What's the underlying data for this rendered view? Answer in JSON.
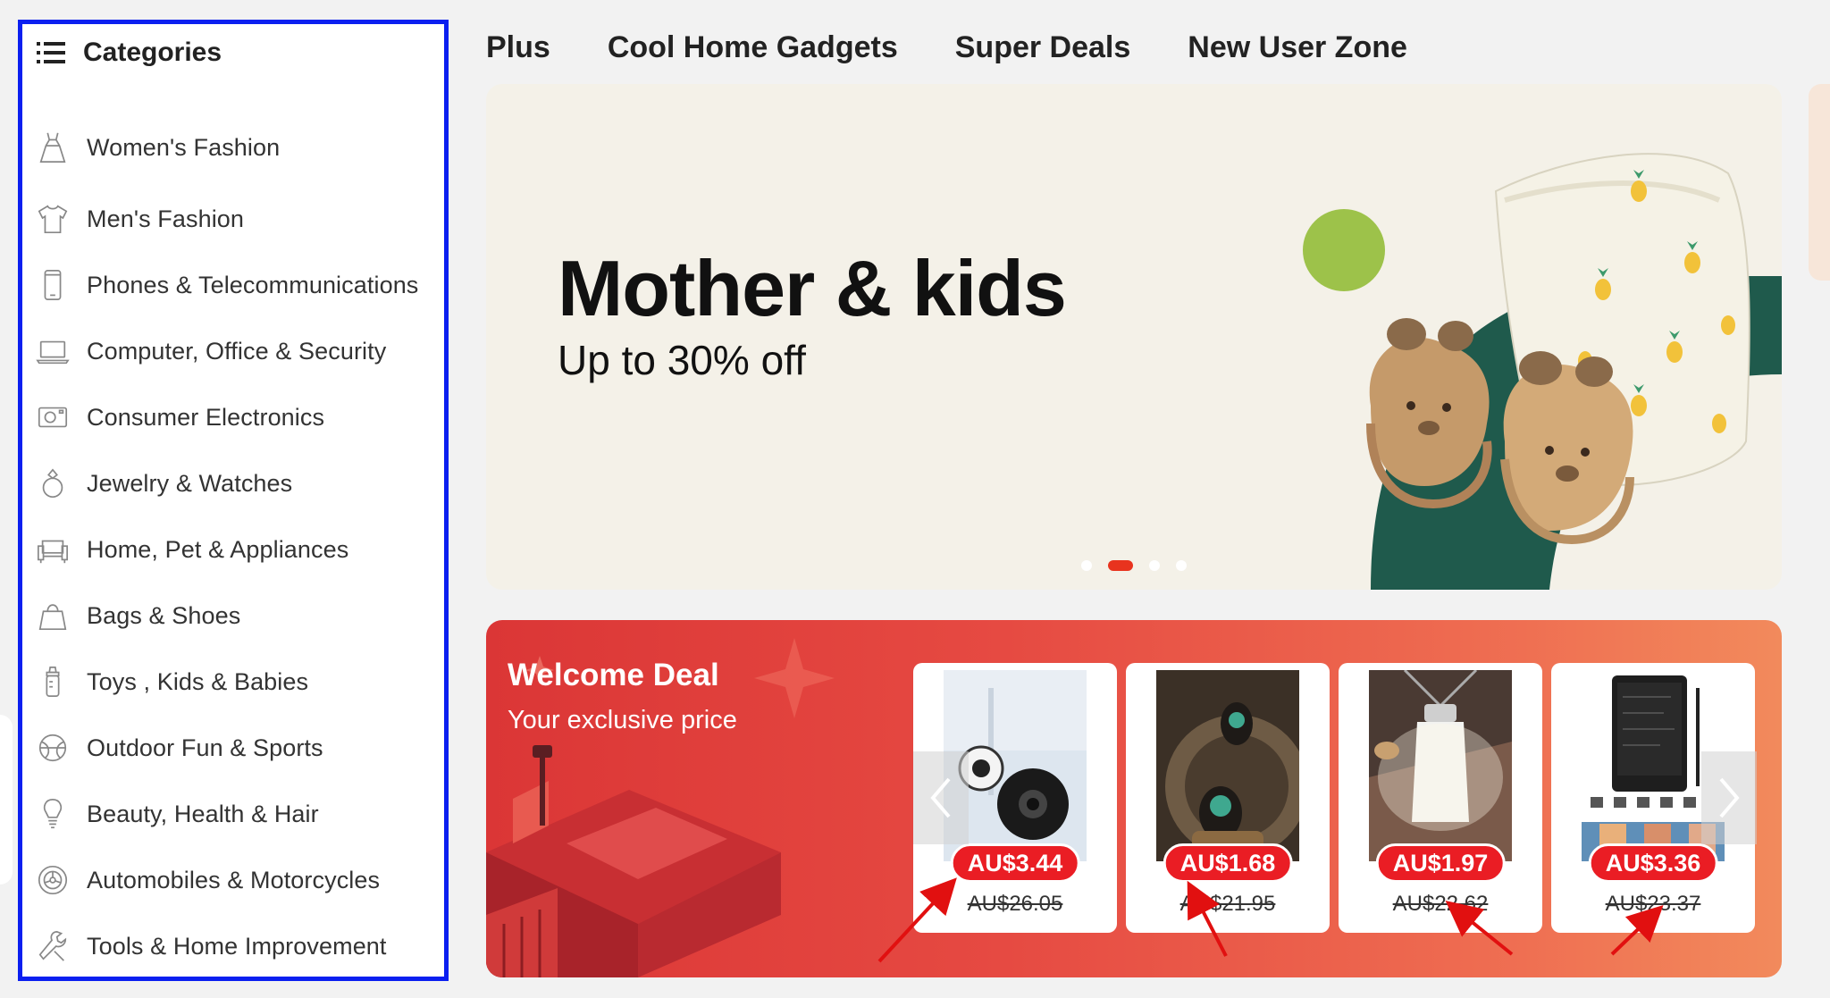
{
  "sidebar": {
    "title": "Categories",
    "items": [
      {
        "label": "Women's Fashion",
        "icon": "dress-icon"
      },
      {
        "label": "Men's Fashion",
        "icon": "shirt-icon"
      },
      {
        "label": "Phones & Telecommunications",
        "icon": "phone-icon"
      },
      {
        "label": "Computer, Office & Security",
        "icon": "laptop-icon"
      },
      {
        "label": "Consumer Electronics",
        "icon": "camera-icon"
      },
      {
        "label": "Jewelry & Watches",
        "icon": "ring-icon"
      },
      {
        "label": "Home, Pet & Appliances",
        "icon": "sofa-icon"
      },
      {
        "label": "Bags & Shoes",
        "icon": "bag-icon"
      },
      {
        "label": "Toys , Kids & Babies",
        "icon": "baby-bottle-icon"
      },
      {
        "label": "Outdoor Fun & Sports",
        "icon": "ball-icon"
      },
      {
        "label": "Beauty, Health & Hair",
        "icon": "lightbulb-icon"
      },
      {
        "label": "Automobiles & Motorcycles",
        "icon": "wheel-icon"
      },
      {
        "label": "Tools & Home Improvement",
        "icon": "tools-icon"
      }
    ]
  },
  "topnav": {
    "links": [
      "Plus",
      "Cool Home Gadgets",
      "Super Deals",
      "New User Zone"
    ]
  },
  "banner": {
    "title": "Mother & kids",
    "subtitle": "Up to 30% off",
    "active_slide": 2,
    "slide_count": 4,
    "accent_color": "#e8331e"
  },
  "deal": {
    "title": "Welcome Deal",
    "subtitle": "Your exclusive price",
    "products": [
      {
        "price": "AU$3.44",
        "old_price": "AU$26.05",
        "image": "security-camera"
      },
      {
        "price": "AU$1.68",
        "old_price": "AU$21.95",
        "image": "wireless-earbuds"
      },
      {
        "price": "AU$1.97",
        "old_price": "AU$22.62",
        "image": "camping-lamp"
      },
      {
        "price": "AU$3.36",
        "old_price": "AU$23.37",
        "image": "lcd-writing-tablet"
      }
    ],
    "price_color": "#ea1d24"
  },
  "annotations": {
    "highlight_color": "#0b1ff0",
    "arrow_color": "#e11010"
  }
}
